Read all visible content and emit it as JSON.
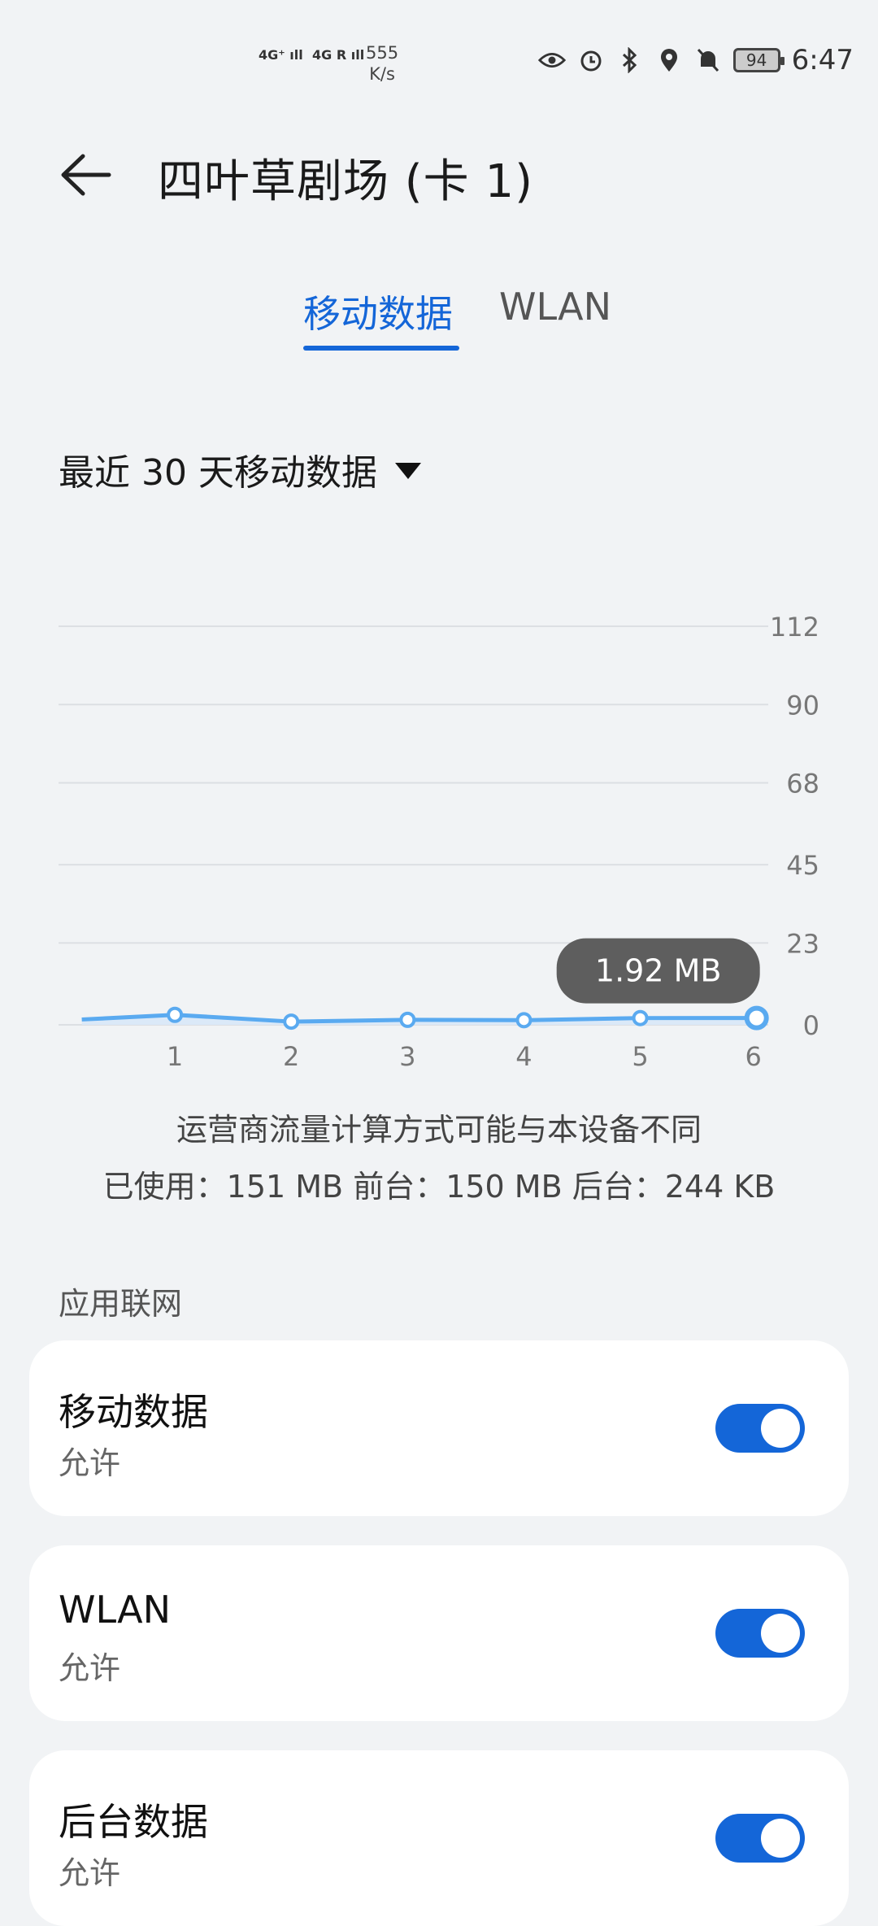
{
  "status": {
    "sig1": "4G⁺ ıll",
    "sig2": "4G R ıll",
    "speed_value": "555",
    "speed_unit": "K/s",
    "battery": "94",
    "time": "6:47"
  },
  "header": {
    "title": "四叶草剧场 (卡 1)"
  },
  "tabs": [
    {
      "label": "移动数据"
    },
    {
      "label": "WLAN"
    }
  ],
  "period": {
    "label": "最近 30 天移动数据"
  },
  "chart_data": {
    "type": "line",
    "x": [
      0.2,
      1,
      2,
      3,
      4,
      5,
      6
    ],
    "values": [
      1.5,
      2.8,
      0.9,
      1.4,
      1.3,
      1.9,
      1.92
    ],
    "point_x": [
      1,
      2,
      3,
      4,
      5,
      6
    ],
    "x_ticks": [
      "1",
      "2",
      "3",
      "4",
      "5",
      "6"
    ],
    "y_ticks": [
      "112",
      "90",
      "68",
      "45",
      "23",
      "0"
    ],
    "y_tick_values": [
      112,
      90,
      68,
      45,
      23,
      0
    ],
    "ylim": [
      0,
      112
    ],
    "tooltip": "1.92 MB",
    "line_color": "#5aaaf0",
    "highlight_color": "#1466d8"
  },
  "notes": {
    "line1": "运营商流量计算方式可能与本设备不同",
    "line2": "已使用：151 MB 前台：150 MB 后台：244 KB"
  },
  "section": {
    "label": "应用联网"
  },
  "cards": [
    {
      "title": "移动数据",
      "sub": "允许"
    },
    {
      "title": "WLAN",
      "sub": "允许"
    },
    {
      "title": "后台数据",
      "sub": "允许"
    }
  ],
  "colors": {
    "accent": "#1466d8",
    "background": "#f1f3f5"
  }
}
